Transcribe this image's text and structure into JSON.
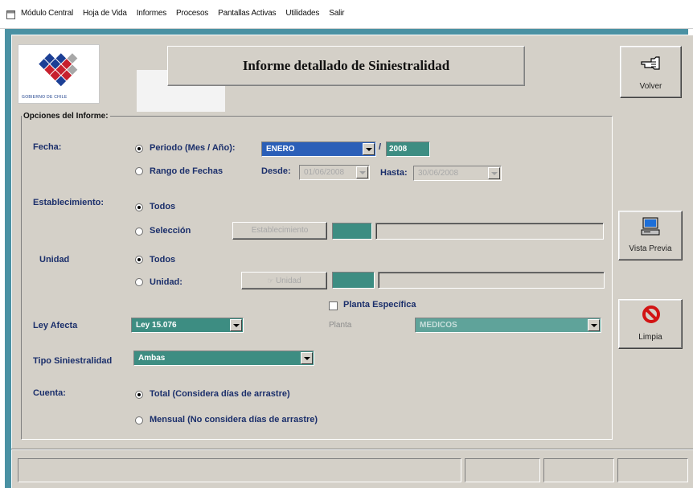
{
  "menu": {
    "items": [
      "Módulo Central",
      "Hoja de Vida",
      "Informes",
      "Procesos",
      "Pantallas Activas",
      "Utilidades",
      "Salir"
    ]
  },
  "logo": {
    "caption": "GOBIERNO DE CHILE"
  },
  "header": {
    "title": "Informe detallado de Siniestralidad"
  },
  "buttons": {
    "volver": "Volver",
    "vista_previa": "Vista Previa",
    "limpia": "Limpia",
    "establecimiento": "Establecimiento",
    "unidad": "Unidad"
  },
  "options": {
    "group_title": "Opciones del Informe:",
    "fecha": {
      "label": "Fecha:",
      "periodo_label": "Periodo (Mes / Año):",
      "month": "ENERO",
      "slash": "/",
      "year": "2008",
      "rango_label": "Rango de Fechas",
      "desde_label": "Desde:",
      "desde_value": "01/06/2008",
      "hasta_label": "Hasta:",
      "hasta_value": "30/06/2008"
    },
    "establecimiento": {
      "label": "Establecimiento:",
      "todos": "Todos",
      "seleccion": "Selección"
    },
    "unidad": {
      "label": "Unidad",
      "todos": "Todos",
      "unidad": "Unidad:"
    },
    "planta_especifica": "Planta Específica",
    "planta_label": "Planta",
    "planta_value": "MEDICOS",
    "ley": {
      "label": "Ley Afecta",
      "value": "Ley 15.076"
    },
    "tipo": {
      "label": "Tipo Siniestralidad",
      "value": "Ambas"
    },
    "cuenta": {
      "label": "Cuenta:",
      "total": "Total (Considera días de arrastre)",
      "mensual": "Mensual (No considera días de arrastre)"
    }
  },
  "status": {
    "panel1": ""
  },
  "colors": {
    "frame": "#4a91a3",
    "field_teal": "#3d8d82",
    "selected_blue": "#2b5fb8",
    "label_blue": "#1b2f6b"
  }
}
